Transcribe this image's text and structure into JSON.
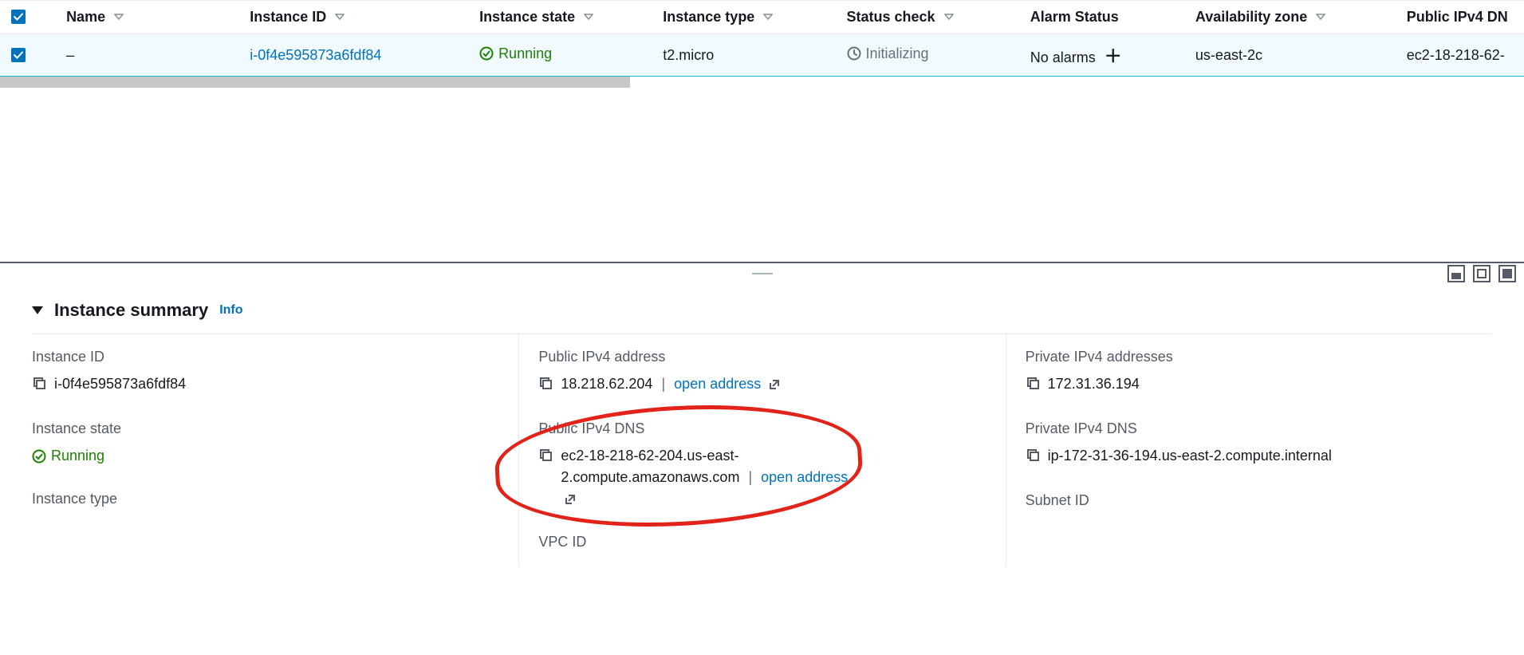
{
  "table": {
    "headers": {
      "name": "Name",
      "instance_id": "Instance ID",
      "instance_state": "Instance state",
      "instance_type": "Instance type",
      "status_check": "Status check",
      "alarm_status": "Alarm Status",
      "az": "Availability zone",
      "public_dns": "Public IPv4 DN"
    },
    "row": {
      "name": "–",
      "instance_id": "i-0f4e595873a6fdf84",
      "instance_state": "Running",
      "instance_type": "t2.micro",
      "status_check": "Initializing",
      "alarm_status": "No alarms",
      "az": "us-east-2c",
      "public_dns": "ec2-18-218-62-"
    }
  },
  "summary": {
    "title": "Instance summary",
    "info_label": "Info",
    "left": {
      "instance_id_label": "Instance ID",
      "instance_id_value": "i-0f4e595873a6fdf84",
      "instance_state_label": "Instance state",
      "instance_state_value": "Running",
      "instance_type_label": "Instance type"
    },
    "mid": {
      "public_ip_label": "Public IPv4 address",
      "public_ip_value": "18.218.62.204",
      "open_address": "open address",
      "public_dns_label": "Public IPv4 DNS",
      "public_dns_value": "ec2-18-218-62-204.us-east-2.compute.amazonaws.com",
      "vpc_label": "VPC ID"
    },
    "right": {
      "private_ip_label": "Private IPv4 addresses",
      "private_ip_value": "172.31.36.194",
      "private_dns_label": "Private IPv4 DNS",
      "private_dns_value": "ip-172-31-36-194.us-east-2.compute.internal",
      "subnet_label": "Subnet ID"
    }
  }
}
